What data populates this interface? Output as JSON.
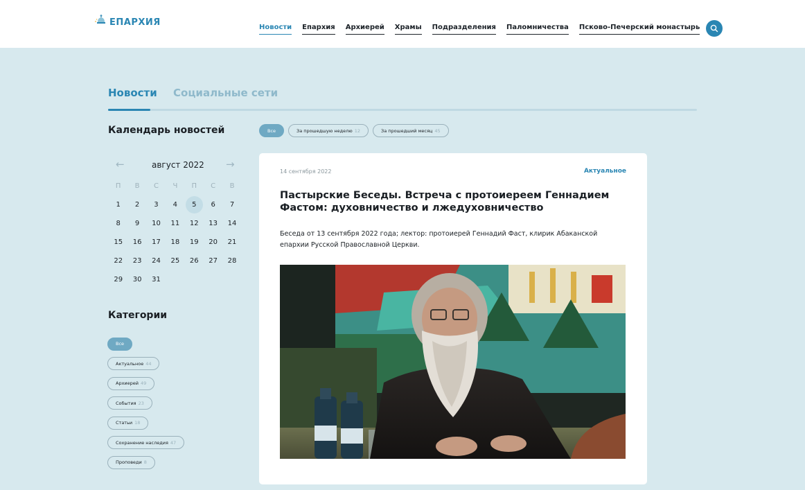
{
  "header": {
    "logo_text": "ЕПАРХИЯ",
    "nav": [
      {
        "label": "Новости",
        "active": true
      },
      {
        "label": "Епархия",
        "active": false
      },
      {
        "label": "Архиерей",
        "active": false
      },
      {
        "label": "Храмы",
        "active": false
      },
      {
        "label": "Подразделения",
        "active": false
      },
      {
        "label": "Паломничества",
        "active": false
      },
      {
        "label": "Псково-Печерский монастырь",
        "active": false
      }
    ],
    "search_icon": "search-icon"
  },
  "tabs": {
    "news": "Новости",
    "social": "Социальные сети"
  },
  "calendar": {
    "title": "Календарь новостей",
    "month": "август 2022",
    "prev_icon": "←",
    "next_icon": "→",
    "weekdays": [
      "П",
      "В",
      "С",
      "Ч",
      "П",
      "С",
      "В"
    ],
    "today": "5",
    "weeks": [
      [
        "1",
        "2",
        "3",
        "4",
        "5",
        "6",
        "7"
      ],
      [
        "8",
        "9",
        "10",
        "11",
        "12",
        "13",
        "14"
      ],
      [
        "15",
        "16",
        "17",
        "18",
        "19",
        "20",
        "21"
      ],
      [
        "22",
        "23",
        "24",
        "25",
        "26",
        "27",
        "28"
      ],
      [
        "29",
        "30",
        "31",
        "",
        "",
        "",
        ""
      ]
    ]
  },
  "categories": {
    "title": "Категории",
    "items": [
      {
        "label": "Все",
        "count": "",
        "active": true
      },
      {
        "label": "Актуальное",
        "count": "44",
        "active": false
      },
      {
        "label": "Архиерей",
        "count": "49",
        "active": false
      },
      {
        "label": "События",
        "count": "23",
        "active": false
      },
      {
        "label": "Статьи",
        "count": "18",
        "active": false
      },
      {
        "label": "Сохранение наследия",
        "count": "47",
        "active": false
      },
      {
        "label": "Проповеди",
        "count": "8",
        "active": false
      }
    ]
  },
  "filters": [
    {
      "label": "Все",
      "count": "",
      "active": true
    },
    {
      "label": "За прошедшую неделю",
      "count": "12",
      "active": false
    },
    {
      "label": "За прошедший месяц",
      "count": "45",
      "active": false
    }
  ],
  "article": {
    "date": "14 сентября 2022",
    "category": "Актуальное",
    "title": "Пастырские Беседы. Встреча с протоиереем Геннадием Фастом: духовничество и лжедуховничество",
    "lead": "Беседа от 13 сентября 2022 года; лектор: протоиерей Геннадий Фаст, клирик Абаканской епархии Русской Православной Церкви."
  },
  "colors": {
    "accent": "#2a86b3",
    "page_bg": "#d7e9ee",
    "pill_active": "#6fa9c3"
  }
}
